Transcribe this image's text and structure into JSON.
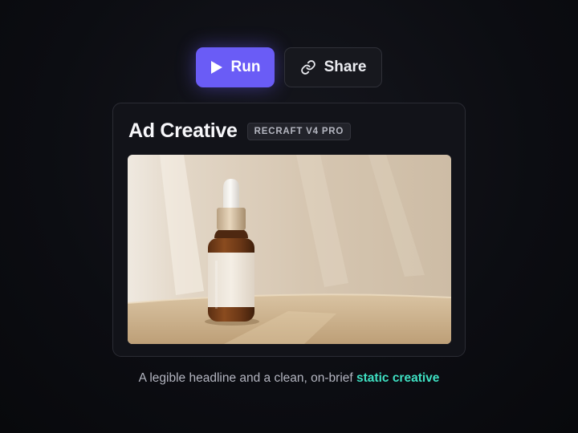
{
  "toolbar": {
    "run_label": "Run",
    "run_icon": "play-icon",
    "share_label": "Share",
    "share_icon": "link-icon"
  },
  "card": {
    "title": "Ad Creative",
    "model_badge": "RECRAFT V4 PRO",
    "image_subject": "product-photo-dropper-bottle"
  },
  "caption": {
    "text": "A legible headline and a clean, on-brief",
    "highlight": "static creative"
  },
  "colors": {
    "background": "#0c0d12",
    "run_button": "#6a5cf6",
    "accent_text": "#3ee0c2",
    "card": "#121319"
  }
}
